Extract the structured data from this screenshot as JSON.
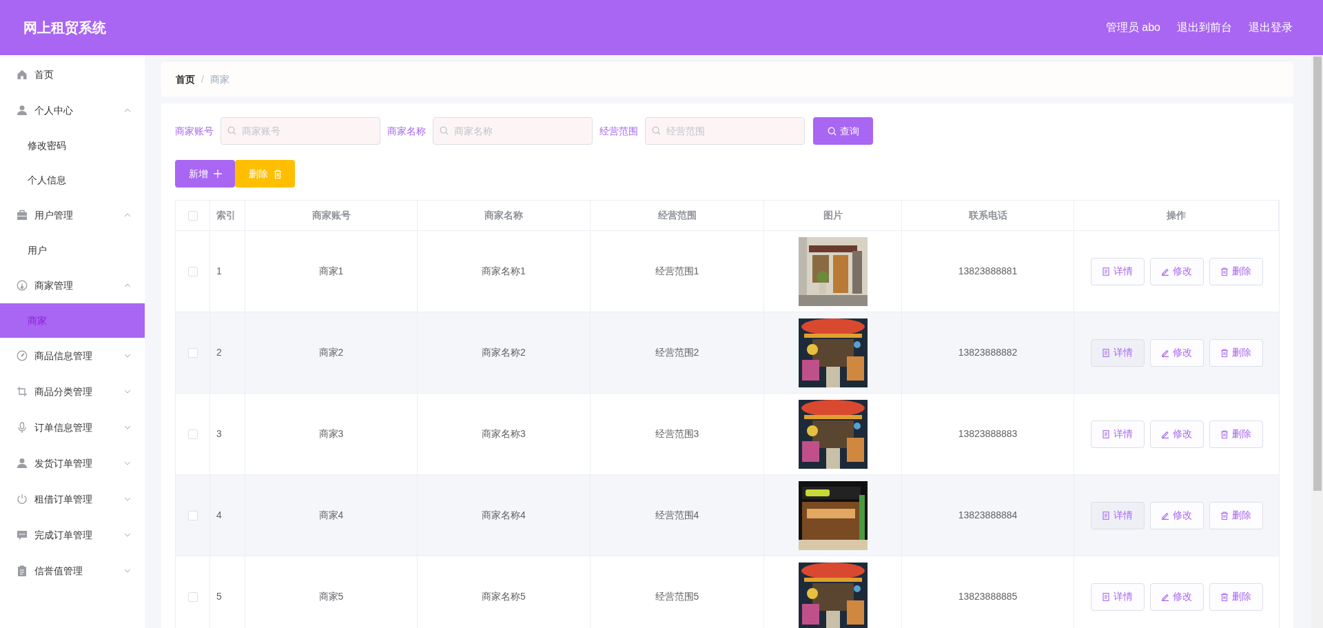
{
  "header": {
    "title": "网上租贸系统",
    "links": [
      "管理员 abo",
      "退出到前台",
      "退出登录"
    ]
  },
  "sidebar": {
    "items": [
      {
        "label": "首页"
      },
      {
        "label": "个人中心",
        "expanded": true,
        "children": [
          {
            "label": "修改密码",
            "selected": false
          },
          {
            "label": "个人信息",
            "selected": false
          }
        ]
      },
      {
        "label": "用户管理",
        "expanded": true,
        "children": [
          {
            "label": "用户",
            "selected": false
          }
        ]
      },
      {
        "label": "商家管理",
        "expanded": true,
        "children": [
          {
            "label": "商家",
            "selected": true
          }
        ]
      },
      {
        "label": "商品信息管理",
        "expanded": false
      },
      {
        "label": "商品分类管理",
        "expanded": false
      },
      {
        "label": "订单信息管理",
        "expanded": false
      },
      {
        "label": "发货订单管理",
        "expanded": false
      },
      {
        "label": "租借订单管理",
        "expanded": false
      },
      {
        "label": "完成订单管理",
        "expanded": false
      },
      {
        "label": "信誉值管理",
        "expanded": false
      }
    ]
  },
  "breadcrumb": {
    "items": [
      "首页",
      "商家"
    ],
    "separator": "/"
  },
  "search": {
    "fields": [
      {
        "label": "商家账号",
        "placeholder": "商家账号"
      },
      {
        "label": "商家名称",
        "placeholder": "商家名称"
      },
      {
        "label": "经营范围",
        "placeholder": "经营范围"
      }
    ],
    "button": "查询"
  },
  "actions": [
    {
      "label": "新增",
      "kind": "add"
    },
    {
      "label": "删除",
      "kind": "delete"
    }
  ],
  "table": {
    "all_checked": false,
    "columns": [
      "索引",
      "商家账号",
      "商家名称",
      "经营范围",
      "图片",
      "联系电话",
      "操作"
    ],
    "rows": [
      {
        "checked": false,
        "index": "1",
        "account": "商家1",
        "name": "商家名称1",
        "scope": "经营范围1",
        "phone": "13823888881",
        "buttons": [
          "详情",
          "修改",
          "删除"
        ]
      },
      {
        "checked": false,
        "index": "2",
        "account": "商家2",
        "name": "商家名称2",
        "scope": "经营范围2",
        "phone": "13823888882",
        "buttons": [
          "详情",
          "修改",
          "删除"
        ]
      },
      {
        "checked": false,
        "index": "3",
        "account": "商家3",
        "name": "商家名称3",
        "scope": "经营范围3",
        "phone": "13823888883",
        "buttons": [
          "详情",
          "修改",
          "删除"
        ]
      },
      {
        "checked": false,
        "index": "4",
        "account": "商家4",
        "name": "商家名称4",
        "scope": "经营范围4",
        "phone": "13823888884",
        "buttons": [
          "详情",
          "修改",
          "删除"
        ]
      },
      {
        "checked": false,
        "index": "5",
        "account": "商家5",
        "name": "商家名称5",
        "scope": "经营范围5",
        "phone": "13823888885",
        "buttons": [
          "详情",
          "修改",
          "删除"
        ]
      }
    ]
  }
}
